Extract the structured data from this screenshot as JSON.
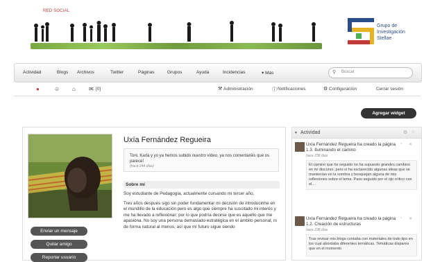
{
  "banner": {
    "brand_small": "RED SOCIAL",
    "logo_text": [
      "Grupo de",
      "Investigación",
      "Stellae"
    ]
  },
  "nav": {
    "items": [
      "Actividad",
      "Blogs",
      "Archivos",
      "Twitter",
      "Páginas",
      "Grupos",
      "Ayuda",
      "Incidencias",
      "▾ Más"
    ],
    "search_placeholder": "Buscar"
  },
  "subbar": {
    "messages_count": "[0]",
    "links": [
      "Administración",
      "Notificaciones",
      "Configuración",
      "Cerrar sesión"
    ]
  },
  "add_widget": "Agregar widget",
  "profile": {
    "name": "Uxía Fernández Regueira",
    "status": "Toni, Karla y yo ya hemos subido nuestro vídeo, ya nos comentaréis que os parece!",
    "status_time": "(hace 244 días)",
    "about_heading": "Sobre mí",
    "about_p1": "Soy estudiante de Pedagogía, actualmente cursando mi tercer año.",
    "about_p2": "Tres años después sigo sin poder fundamentar mi decisión de introducirme en el mundillo de la educación pero es algo que siempre ha suscitado mi interés y me ha llevado a reflexionar; por lo que podría decirse que es aquello que me apasiona. No soy una persona demasiado estratégica en el ámbito personal, ni de forma natural al menos; así que mi futuro sigue siendo",
    "buttons": [
      "Enviar un mensaje",
      "Quitar amigo",
      "Reportar usuario"
    ]
  },
  "activity": {
    "title": "Actividad",
    "entries": [
      {
        "title": "Uxía Fernández Regueira ha creado la página 1.3. Iluminando el camino",
        "time": "hace 238 días",
        "excerpt": "El camino que he seguido no ha supuesto grandes cambios en mi discurso, pero sí ha esclarecido algunas ideas que se mantenían en la sombra y bosquejan alguna de mis reflexiones sobre el tema. Paso seguido por el ojo crítico con el..."
      },
      {
        "title": "Uxía Fernández Regueira ha creado la página 1.2. Creación de estructuras",
        "time": "hace 238 días",
        "excerpt": "Tras revisar mis blogs contaba con materiales de todo tipo en los cual abordaba diferentes temáticas. Temáticas dispares que en el momento"
      }
    ]
  },
  "colors": {
    "brand_red": "#c03a3a",
    "logo_blue": "#2b4c8c",
    "grass_green": "#6a9e2d",
    "dark_button": "#333333"
  }
}
